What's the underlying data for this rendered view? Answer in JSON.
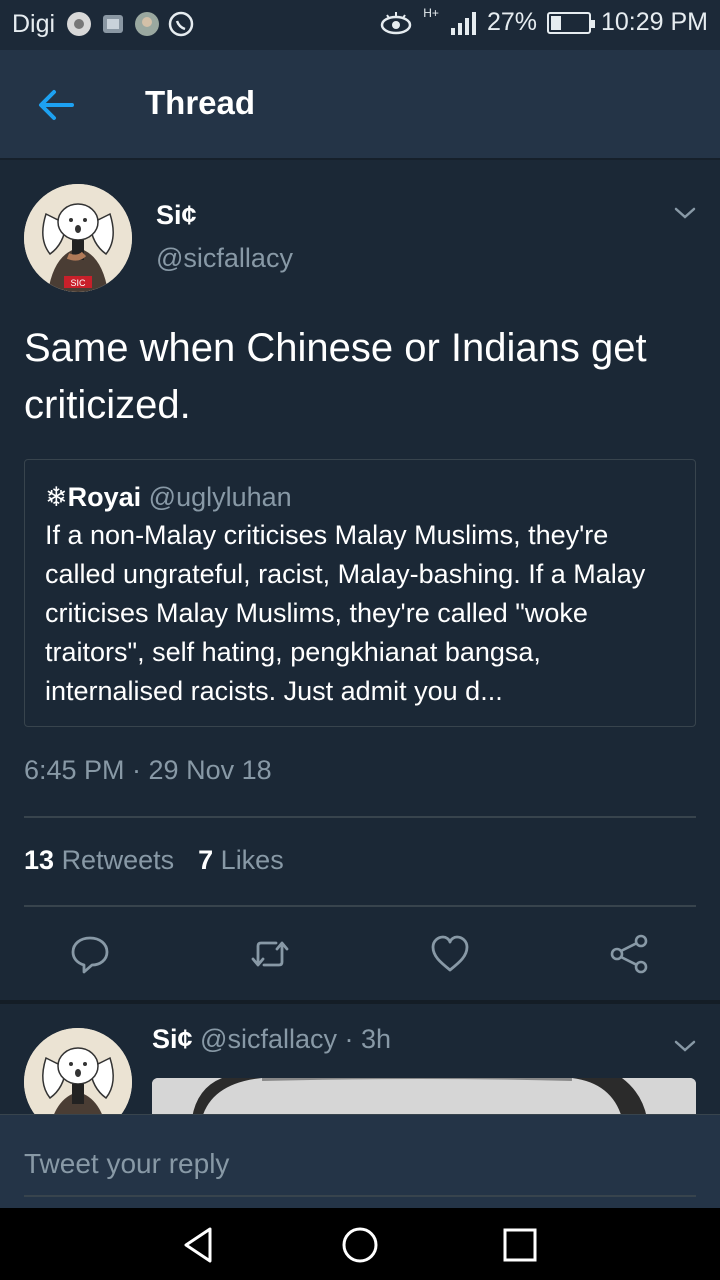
{
  "status_bar": {
    "carrier": "Digi",
    "battery": "27%",
    "battery_level": 0.27,
    "network": "H+",
    "time": "10:29 PM",
    "icons": [
      "chrome-icon",
      "gallery-icon",
      "app-icon",
      "whatsapp-icon",
      "eye-icon",
      "signal-icon",
      "battery-icon"
    ]
  },
  "header": {
    "title": "Thread"
  },
  "tweet": {
    "name": "Si¢",
    "handle": "@sicfallacy",
    "avatar_badge": "SIC",
    "text": "Same when Chinese or Indians get criticized.",
    "quote": {
      "name": "❄Royai",
      "handle": "@uglyluhan",
      "text": "If a non-Malay criticises Malay Muslims, they're called ungrateful, racist, Malay-bashing. If a Malay criticises Malay Muslims, they're called \"woke traitors\", self hating, pengkhianat bangsa, internalised racists. Just admit you d..."
    },
    "timestamp": "6:45 PM · 29 Nov 18",
    "retweets_count": "13",
    "retweets_label": "Retweets",
    "likes_count": "7",
    "likes_label": "Likes"
  },
  "reply": {
    "name": "Si¢",
    "handle": "@sicfallacy",
    "time": "· 3h"
  },
  "composer": {
    "placeholder": "Tweet your reply"
  },
  "colors": {
    "background": "#1b2836",
    "appbar": "#243447",
    "accent": "#1da1f2",
    "secondary_text": "#8899a6",
    "divider": "#38444d"
  }
}
